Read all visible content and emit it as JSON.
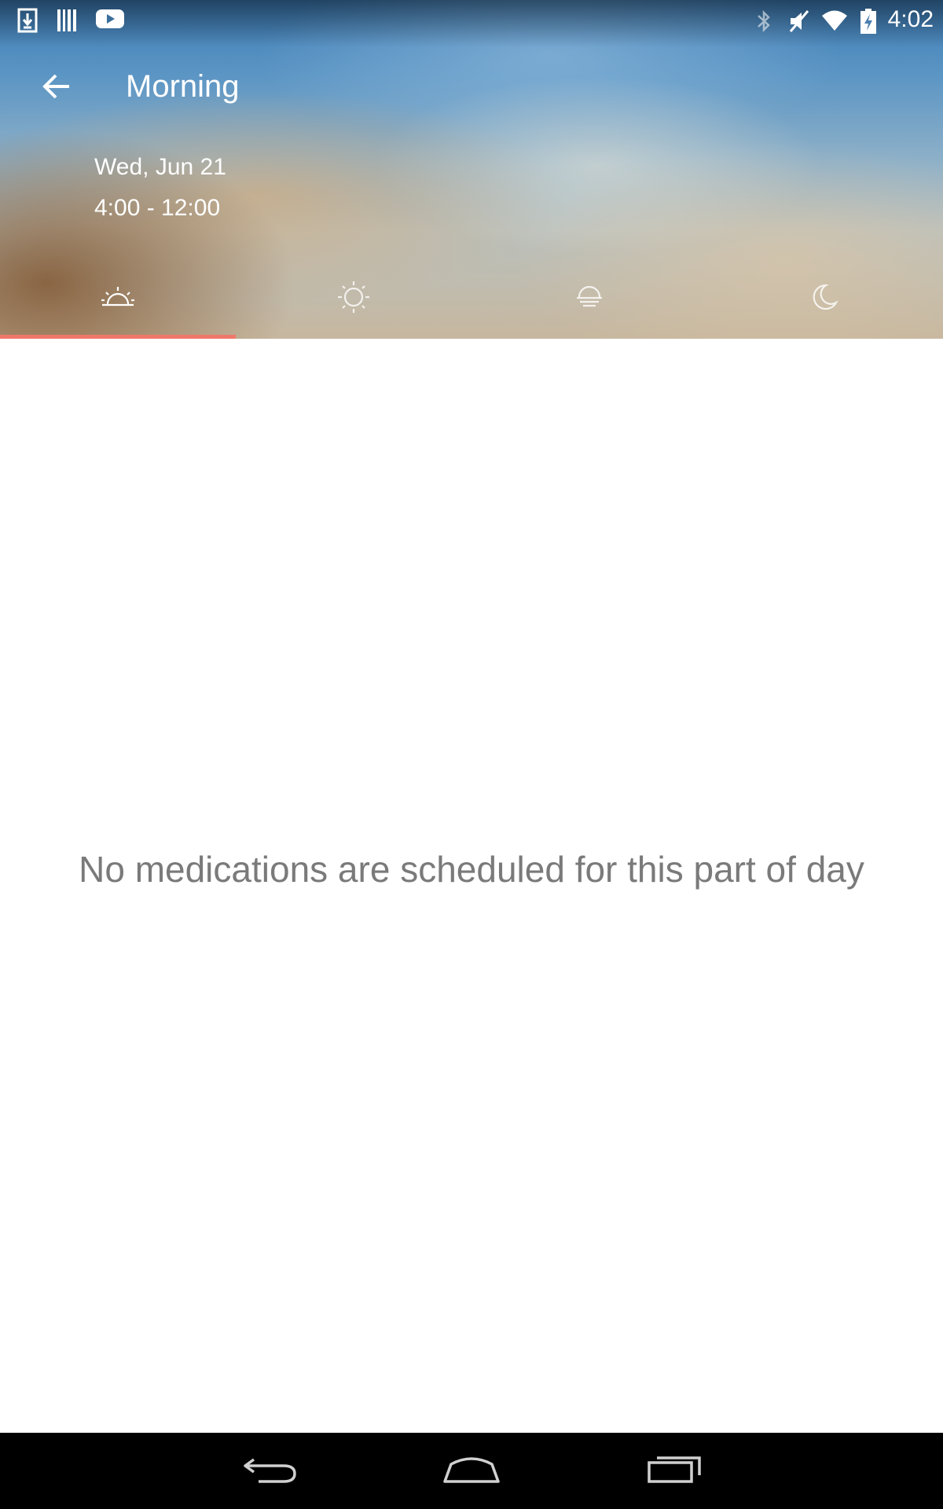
{
  "status_bar": {
    "left_icons": [
      "download-icon",
      "barcode-icon",
      "youtube-icon"
    ],
    "right_icons": [
      "bluetooth-icon",
      "mute-icon",
      "wifi-icon",
      "battery-charging-icon"
    ],
    "time": "4:02"
  },
  "toolbar": {
    "back_icon": "arrow-left-icon",
    "title": "Morning"
  },
  "header": {
    "date": "Wed, Jun 21",
    "time_range": "4:00 - 12:00"
  },
  "tabs": [
    {
      "icon": "sunrise-icon",
      "selected": true
    },
    {
      "icon": "sun-icon",
      "selected": false
    },
    {
      "icon": "sunset-icon",
      "selected": false
    },
    {
      "icon": "moon-icon",
      "selected": false
    }
  ],
  "colors": {
    "accent": "#f0786a",
    "empty_text": "#7a7a7a",
    "nav_bar": "#000000"
  },
  "content": {
    "empty_message": "No medications are scheduled for this part of day"
  },
  "nav_bar": {
    "buttons": [
      "back-nav-icon",
      "home-nav-icon",
      "recents-nav-icon"
    ]
  }
}
